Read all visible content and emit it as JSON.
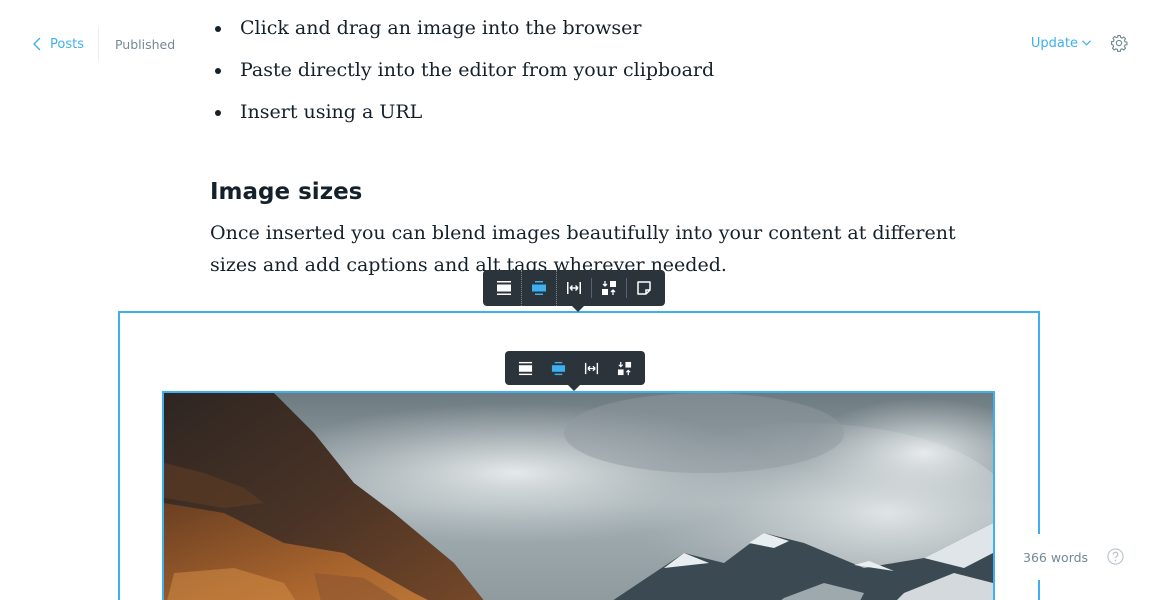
{
  "header": {
    "back_label": "Posts",
    "status": "Published",
    "update_label": "Update"
  },
  "content": {
    "bullets": [
      "Click and drag an image into the browser",
      "Paste directly into the editor from your clipboard",
      "Insert using a URL"
    ],
    "section_title": "Image sizes",
    "section_text": "Once inserted you can blend images beautifully into your content at different sizes and add captions and alt tags wherever needed."
  },
  "card_toolbar": {
    "buttons": [
      "wide-layout-icon",
      "normal-layout-icon",
      "full-width-icon",
      "replace-image-icon",
      "snippet-icon"
    ],
    "active": "normal-layout-icon"
  },
  "image_toolbar": {
    "buttons": [
      "wide-layout-icon",
      "normal-layout-icon",
      "full-width-icon",
      "replace-image-icon"
    ],
    "active": "normal-layout-icon"
  },
  "footer": {
    "word_count": "366 words"
  },
  "colors": {
    "accent": "#3eb0ef",
    "muted": "#738a94",
    "toolbar_bg": "#2b343a",
    "text": "#15212a"
  }
}
